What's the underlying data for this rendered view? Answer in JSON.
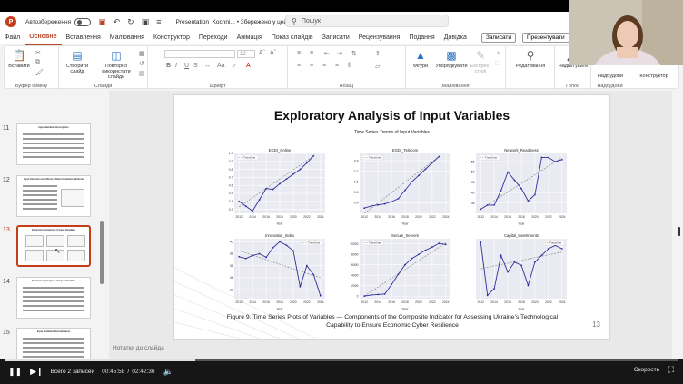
{
  "titlebar": {
    "logo_letter": "P",
    "autosave_label": "Автозбереження",
    "doc_title": "Presentation_Kochni... • Збережено у цей ПК ˅",
    "search_placeholder": "Пошук"
  },
  "menu": {
    "tabs": [
      "Файл",
      "Основне",
      "Вставлення",
      "Малювання",
      "Конструктор",
      "Переходи",
      "Анімація",
      "Показ слайдів",
      "Записати",
      "Рецензування",
      "Подання",
      "Довідка"
    ],
    "active_index": 1,
    "record_button": "Записати",
    "present_button": "Презентувати"
  },
  "ribbon": {
    "paste": "Вставити",
    "clipboard_group": "Буфер обміну",
    "new_slide": "Створити слайд",
    "reuse_slides": "Повторно використати слайди",
    "slides_group": "Слайди",
    "font_group": "Шрифт",
    "paragraph_group": "Абзац",
    "shapes": "Фігури",
    "arrange": "Упорядкувати",
    "quick_styles": "Експрес-стилі",
    "drawing_group": "Малювання",
    "editing": "Редагування",
    "dictate": "Надиктувати",
    "voice_group": "Голос",
    "addins": "Надбудови",
    "addins_group": "Надбудови",
    "designer": "Конструктор",
    "font_size": "12"
  },
  "thumbnails": {
    "numbers": [
      "11",
      "12",
      "13",
      "14",
      "15"
    ],
    "selected_number": "13",
    "captions": [
      "Input Variables Description",
      "Input Selection and Missing Data Imputation Methods",
      "Exploratory Analysis of Input Variables",
      "Exploratory Analysis of Input Variables",
      "Input Variables Normalization"
    ]
  },
  "slide": {
    "title": "Exploratory Analysis of Input Variables",
    "figure_title": "Time Series Trends of Input Variables",
    "caption_line1": "Figure 9. Time Series Plots of Variables — Components of the Composite Indicator for Assessing Ukraine's Technological",
    "caption_line2": "Capability to Ensure Economic Cyber Resilience",
    "number": "13",
    "notes": "Нотатки до слайда"
  },
  "chart_data": [
    {
      "type": "line",
      "title": "EGDI_Online",
      "xlabel": "Year",
      "ylabel": "",
      "x": [
        2012,
        2013,
        2014,
        2015,
        2016,
        2017,
        2018,
        2019,
        2020,
        2021,
        2022,
        2023
      ],
      "values": [
        0.4,
        0.34,
        0.28,
        0.42,
        0.56,
        0.55,
        0.62,
        0.68,
        0.74,
        0.8,
        0.88,
        0.97
      ],
      "trend": [
        0.33,
        0.97
      ],
      "ylim": [
        0.25,
        1.0
      ],
      "yticks": [
        "0.3",
        "0.4",
        "0.5",
        "0.6",
        "0.7",
        "0.8",
        "0.9",
        "1.0"
      ],
      "xticks": [
        "2012",
        "2014",
        "2016",
        "2018",
        "2020",
        "2022",
        "2024"
      ],
      "legend": "Trend line",
      "grid": true
    },
    {
      "type": "line",
      "title": "EGDI_Telecom",
      "xlabel": "Year",
      "ylabel": "",
      "x": [
        2012,
        2013,
        2014,
        2015,
        2016,
        2017,
        2018,
        2019,
        2020,
        2021,
        2022,
        2023
      ],
      "values": [
        0.35,
        0.37,
        0.38,
        0.39,
        0.41,
        0.44,
        0.52,
        0.6,
        0.66,
        0.72,
        0.78,
        0.84
      ],
      "trend": [
        0.3,
        0.84
      ],
      "ylim": [
        0.3,
        0.87
      ],
      "yticks": [
        "0.4",
        "0.5",
        "0.6",
        "0.7",
        "0.8"
      ],
      "xticks": [
        "2012",
        "2014",
        "2016",
        "2018",
        "2020",
        "2022",
        "2024"
      ],
      "legend": "Trend line",
      "grid": true
    },
    {
      "type": "line",
      "title": "Network_Readiness",
      "xlabel": "Year",
      "ylabel": "",
      "x": [
        2012,
        2013,
        2014,
        2015,
        2016,
        2017,
        2018,
        2019,
        2020,
        2021,
        2022,
        2023
      ],
      "values": [
        32,
        34,
        34,
        41,
        50,
        46,
        42,
        36,
        39,
        57,
        57,
        55,
        56
      ],
      "x_full": [
        2012,
        2013,
        2014,
        2015,
        2016,
        2017,
        2018,
        2019,
        2020,
        2021,
        2022,
        2023,
        2024
      ],
      "trend": [
        32,
        57
      ],
      "ylim": [
        30,
        59
      ],
      "yticks": [
        "35",
        "40",
        "45",
        "50",
        "55"
      ],
      "xticks": [
        "2012",
        "2014",
        "2016",
        "2018",
        "2020",
        "2022",
        "2024"
      ],
      "legend": "Trend line",
      "grid": true
    },
    {
      "type": "line",
      "title": "Innovation_Index",
      "xlabel": "Year",
      "ylabel": "",
      "x": [
        2012,
        2013,
        2014,
        2015,
        2016,
        2017,
        2018,
        2019,
        2020,
        2021,
        2022,
        2023,
        2024
      ],
      "values": [
        37.5,
        37.2,
        37.7,
        38.0,
        37.4,
        39.0,
        40.0,
        39.4,
        38.5,
        32.5,
        36.0,
        34.5,
        31.0
      ],
      "trend": [
        38.5,
        34.0
      ],
      "ylim": [
        30.5,
        40.5
      ],
      "yticks": [
        "32",
        "34",
        "36",
        "38",
        "40"
      ],
      "xticks": [
        "2012",
        "2014",
        "2016",
        "2018",
        "2020",
        "2022",
        "2024"
      ],
      "legend": "Trend line",
      "grid": true
    },
    {
      "type": "line",
      "title": "Secure_Servers",
      "xlabel": "Year",
      "ylabel": "",
      "x": [
        2012,
        2013,
        2014,
        2015,
        2016,
        2017,
        2018,
        2019,
        2020,
        2021,
        2022,
        2023,
        2024
      ],
      "values": [
        0,
        200,
        300,
        400,
        2200,
        4200,
        6000,
        7200,
        8000,
        8800,
        9400,
        10100,
        9900
      ],
      "trend": [
        0,
        10200
      ],
      "ylim": [
        -500,
        11000
      ],
      "yticks": [
        "0",
        "2000",
        "4000",
        "6000",
        "8000",
        "10000"
      ],
      "xticks": [
        "2012",
        "2014",
        "2016",
        "2018",
        "2020",
        "2022",
        "2024"
      ],
      "legend": "Trend line",
      "grid": true
    },
    {
      "type": "line",
      "title": "Capital_Investments",
      "xlabel": "Year",
      "ylabel": "",
      "x": [
        2012,
        2013,
        2014,
        2015,
        2016,
        2017,
        2018,
        2019,
        2020,
        2021,
        2022,
        2023,
        2024
      ],
      "values": [
        24,
        8,
        10,
        20,
        15,
        18,
        17,
        11,
        18,
        20,
        22,
        23,
        22
      ],
      "trend": [
        16,
        21
      ],
      "ylim": [
        7,
        25
      ],
      "yticks": [],
      "xticks": [
        "2012",
        "2014",
        "2016",
        "2018",
        "2020",
        "2022",
        "2024"
      ],
      "legend": "Trend line",
      "grid": true
    }
  ],
  "player": {
    "total_label": "Всего 2 записей",
    "time_current": "00:45:58",
    "time_total": "02:42:36",
    "progress": 0.283,
    "speed_label": "Скорость"
  },
  "colors": {
    "accent": "#c43e1c",
    "series_line": "#2f2f9a",
    "trend_line": "#8c8c8c"
  }
}
